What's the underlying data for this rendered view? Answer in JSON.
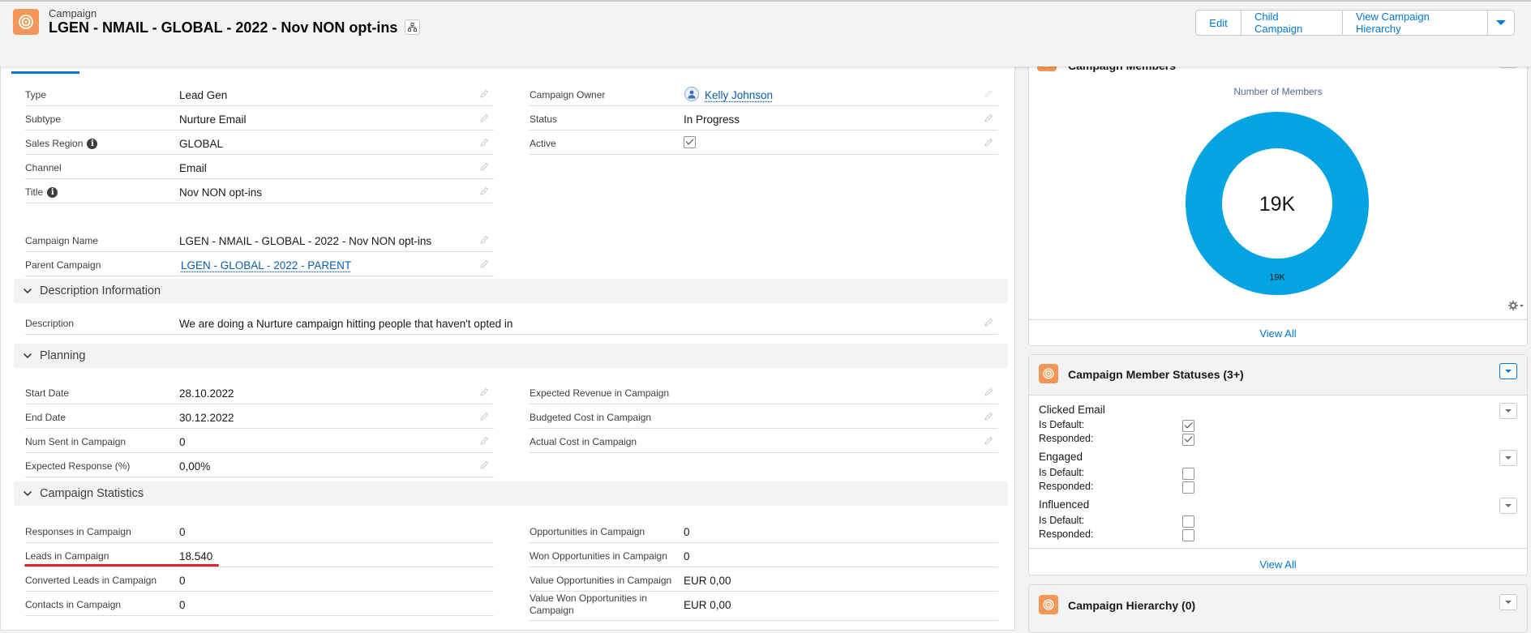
{
  "header": {
    "eyebrow": "Campaign",
    "title": "LGEN - NMAIL - GLOBAL - 2022 - Nov NON opt-ins",
    "buttons": [
      "Edit",
      "Child Campaign",
      "View Campaign Hierarchy"
    ]
  },
  "fields": {
    "type": {
      "label": "Type",
      "value": "Lead Gen"
    },
    "subtype": {
      "label": "Subtype",
      "value": "Nurture Email"
    },
    "sales_region": {
      "label": "Sales Region",
      "value": "GLOBAL"
    },
    "channel": {
      "label": "Channel",
      "value": "Email"
    },
    "title": {
      "label": "Title",
      "value": "Nov NON opt-ins"
    },
    "campaign_name": {
      "label": "Campaign Name",
      "value": "LGEN - NMAIL - GLOBAL - 2022 - Nov NON opt-ins"
    },
    "parent_campaign": {
      "label": "Parent Campaign",
      "value": "LGEN - GLOBAL - 2022 - PARENT"
    },
    "campaign_owner": {
      "label": "Campaign Owner",
      "value": "Kelly Johnson"
    },
    "status": {
      "label": "Status",
      "value": "In Progress"
    },
    "active": {
      "label": "Active",
      "checked": true
    }
  },
  "sections": {
    "description": {
      "title": "Description Information",
      "description_label": "Description",
      "description_value": "We are doing a Nurture campaign hitting people that haven't opted in"
    },
    "planning": {
      "title": "Planning",
      "start_date": {
        "label": "Start Date",
        "value": "28.10.2022"
      },
      "end_date": {
        "label": "End Date",
        "value": "30.12.2022"
      },
      "num_sent": {
        "label": "Num Sent in Campaign",
        "value": "0"
      },
      "expected_response": {
        "label": "Expected Response (%)",
        "value": "0,00%"
      },
      "expected_revenue": {
        "label": "Expected Revenue in Campaign",
        "value": ""
      },
      "budgeted_cost": {
        "label": "Budgeted Cost in Campaign",
        "value": ""
      },
      "actual_cost": {
        "label": "Actual Cost in Campaign",
        "value": ""
      }
    },
    "statistics": {
      "title": "Campaign Statistics",
      "responses": {
        "label": "Responses in Campaign",
        "value": "0"
      },
      "leads": {
        "label": "Leads in Campaign",
        "value": "18.540"
      },
      "converted_leads": {
        "label": "Converted Leads in Campaign",
        "value": "0"
      },
      "contacts": {
        "label": "Contacts in Campaign",
        "value": "0"
      },
      "opportunities": {
        "label": "Opportunities in Campaign",
        "value": "0"
      },
      "won_opportunities": {
        "label": "Won Opportunities in Campaign",
        "value": "0"
      },
      "value_opportunities": {
        "label": "Value Opportunities in Campaign",
        "value": "EUR 0,00"
      },
      "value_won_line1": "Value Won Opportunities in",
      "value_won_line2": "Campaign",
      "value_won_value": "EUR 0,00"
    }
  },
  "members_card": {
    "title": "Campaign Members",
    "chart_title": "Number of Members",
    "view_all": "View All"
  },
  "chart_data": {
    "type": "pie",
    "title": "Number of Members",
    "categories": [
      "Members"
    ],
    "values": [
      19000
    ],
    "center_label": "19K",
    "slice_label": "19K",
    "color": "#04a4e4"
  },
  "statuses_card": {
    "title": "Campaign Member Statuses (3+)",
    "is_default_label": "Is Default:",
    "responded_label": "Responded:",
    "statuses": [
      {
        "name": "Clicked Email",
        "is_default": true,
        "responded": true
      },
      {
        "name": "Engaged",
        "is_default": false,
        "responded": false
      },
      {
        "name": "Influenced",
        "is_default": false,
        "responded": false
      }
    ],
    "view_all": "View All"
  },
  "hierarchy_card": {
    "title": "Campaign Hierarchy (0)"
  },
  "colors": {
    "brand_blue": "#0176d3",
    "campaign_orange": "#f49756",
    "chart_blue": "#04a4e4",
    "highlight_red": "#d6272c"
  },
  "icons": [
    "campaign-icon",
    "hierarchy-icon",
    "chevron-down-icon",
    "pencil-icon",
    "info-icon",
    "checkbox-icon",
    "gear-icon",
    "avatar"
  ]
}
